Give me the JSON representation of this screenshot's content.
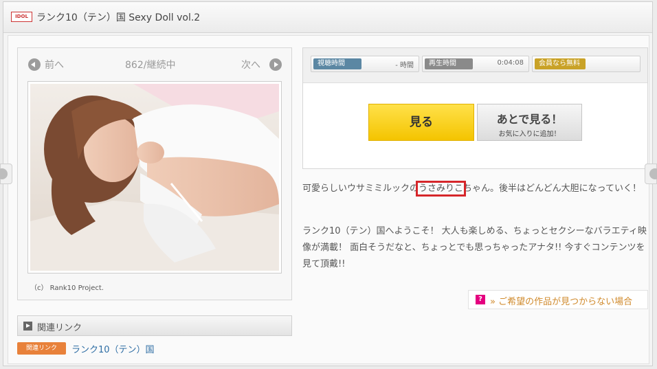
{
  "header": {
    "badge": "IDOL",
    "title": "ランク10（テン）国 Sexy Doll vol.2"
  },
  "nav": {
    "prev_label": "前へ",
    "counter": "862/継続中",
    "next_label": "次へ"
  },
  "photo": {
    "copyright": "（c） Rank10 Project."
  },
  "related": {
    "section_title": "関連リンク",
    "tag": "関連リンク",
    "link_text": "ランク10（テン）国"
  },
  "stats": {
    "view_time_label": "視聴時間",
    "view_time_value": "- 時間",
    "play_time_label": "再生時間",
    "play_time_value": "0:04:08",
    "member_label": "会員なら無料",
    "colors": {
      "view_time": "#5b87a3",
      "play_time": "#8a8a8a",
      "member": "#c9a227"
    }
  },
  "buttons": {
    "watch_label": "見る",
    "watch_later_label": "あとで見る！",
    "watch_later_sub": "お気に入りに追加！"
  },
  "description": {
    "line1_before": "可愛らしいウサミミルックの",
    "line1_highlight": "うさみりこ",
    "line1_after": "ちゃん。後半はどんどん大胆になっていく！",
    "paragraph2": "ランク10（テン）国へようこそ！ 大人も楽しめる、ちょっとセクシーなバラエティ映像が満載！ 面白そうだなと、ちょっとでも思っちゃったアナタ!! 今すぐコンテンツを見て頂戴!!"
  },
  "not_found": {
    "icon": "?",
    "text": "» ご希望の作品が見つからない場合"
  }
}
